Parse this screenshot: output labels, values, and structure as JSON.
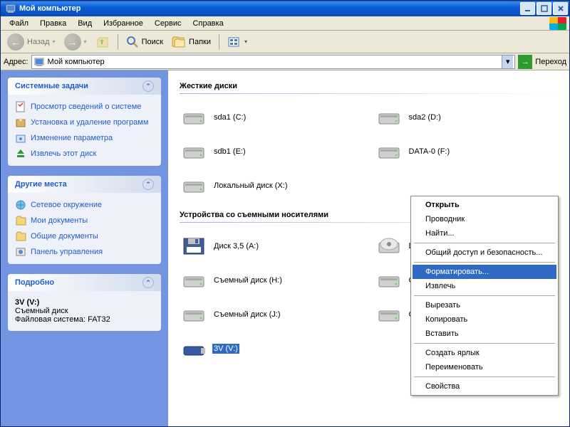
{
  "title": "Мой компьютер",
  "menubar": [
    "Файл",
    "Правка",
    "Вид",
    "Избранное",
    "Сервис",
    "Справка"
  ],
  "toolbar": {
    "back": "Назад",
    "search": "Поиск",
    "folders": "Папки"
  },
  "addressbar": {
    "label": "Адрес:",
    "value": "Мой компьютер",
    "go": "Переход"
  },
  "sidebar": {
    "tasks": {
      "title": "Системные задачи",
      "items": [
        "Просмотр сведений о системе",
        "Установка и удаление программ",
        "Изменение параметра",
        "Извлечь этот диск"
      ]
    },
    "places": {
      "title": "Другие места",
      "items": [
        "Сетевое окружение",
        "Мои документы",
        "Общие документы",
        "Панель управления"
      ]
    },
    "details": {
      "title": "Подробно",
      "name": "3V (V:)",
      "type": "Съемный диск",
      "fs": "Файловая система: FAT32"
    }
  },
  "sections": {
    "hdd": {
      "title": "Жесткие диски",
      "items": [
        {
          "label": "sda1 (C:)"
        },
        {
          "label": "sda2 (D:)"
        },
        {
          "label": "sdb1 (E:)"
        },
        {
          "label": "DATA-0 (F:)"
        },
        {
          "label": "Локальный диск (X:)"
        }
      ]
    },
    "removable": {
      "title": "Устройства со съемными носителями",
      "items": [
        {
          "label": "Диск 3,5 (A:)",
          "icon": "floppy"
        },
        {
          "label": "DVD-RAM дисковод (G:)",
          "icon": "cd"
        },
        {
          "label": "Съемный диск (H:)",
          "icon": "hdd"
        },
        {
          "label": "Съемный диск (I:)",
          "icon": "hdd"
        },
        {
          "label": "Съемный диск (J:)",
          "icon": "hdd"
        },
        {
          "label": "Съемный диск (K:)",
          "icon": "hdd"
        },
        {
          "label": "3V (V:)",
          "icon": "usb",
          "selected": true
        }
      ]
    }
  },
  "context_menu": [
    {
      "label": "Открыть",
      "bold": true
    },
    {
      "label": "Проводник"
    },
    {
      "label": "Найти..."
    },
    {
      "sep": true
    },
    {
      "label": "Общий доступ и безопасность..."
    },
    {
      "sep": true
    },
    {
      "label": "Форматировать...",
      "highlight": true
    },
    {
      "label": "Извлечь"
    },
    {
      "sep": true
    },
    {
      "label": "Вырезать"
    },
    {
      "label": "Копировать"
    },
    {
      "label": "Вставить"
    },
    {
      "sep": true
    },
    {
      "label": "Создать ярлык"
    },
    {
      "label": "Переименовать"
    },
    {
      "sep": true
    },
    {
      "label": "Свойства"
    }
  ]
}
